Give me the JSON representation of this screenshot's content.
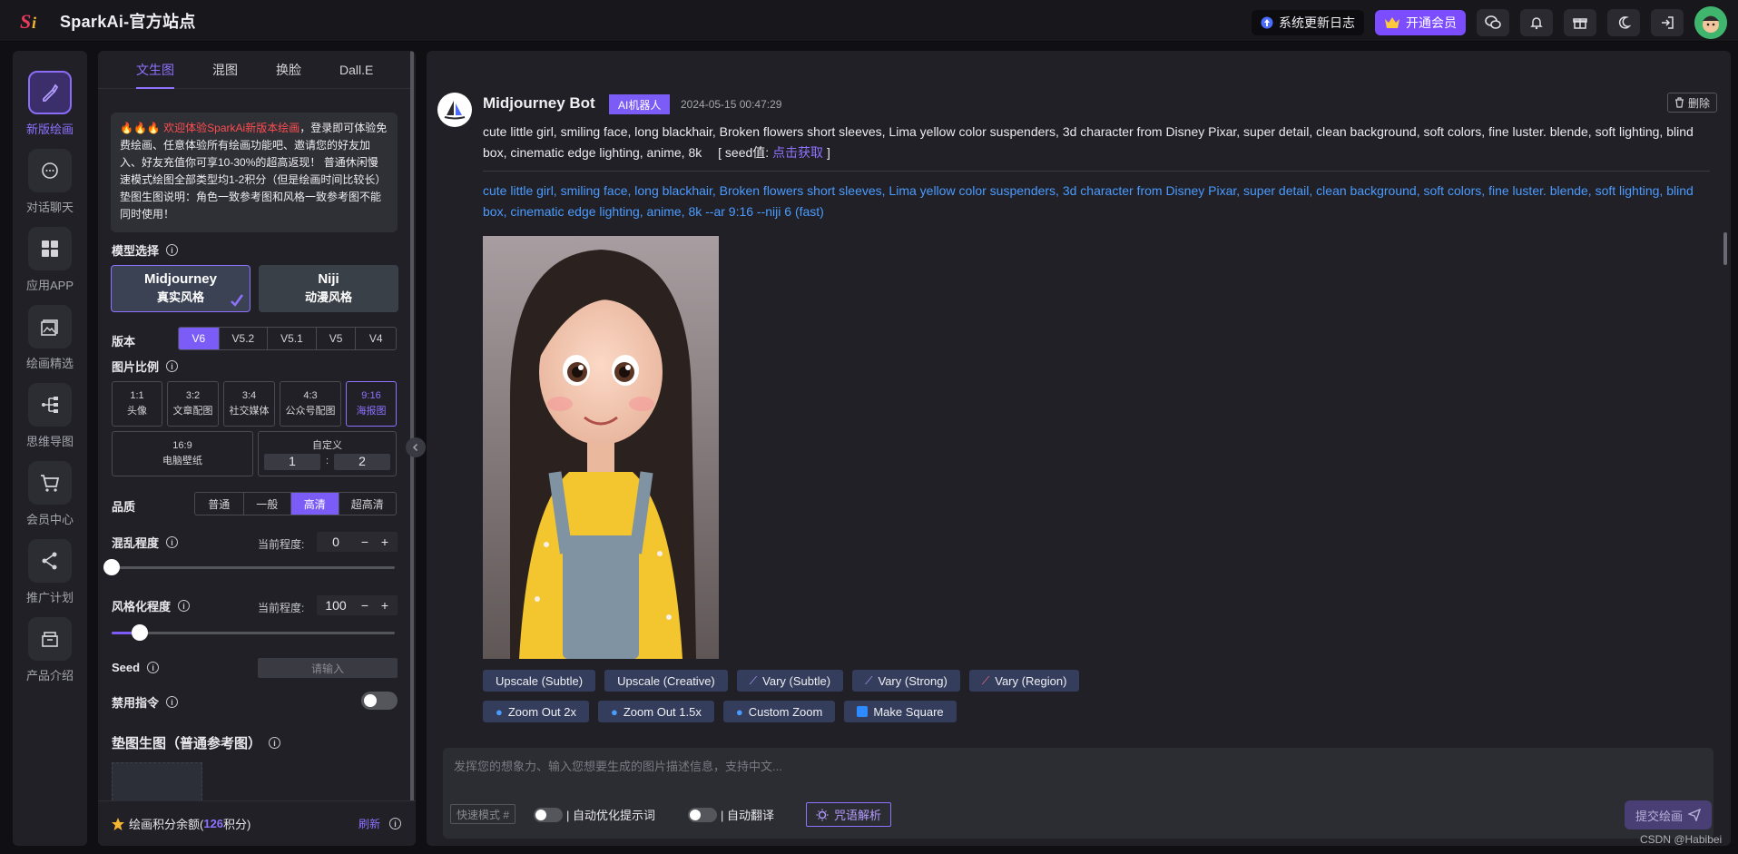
{
  "app": {
    "title": "SparkAi-官方站点",
    "logo_text": "Si"
  },
  "topbar": {
    "changelog_label": "系统更新日志",
    "vip_label": "开通会员",
    "icons": [
      "wechat-icon",
      "bell-icon",
      "gift-icon",
      "moon-icon",
      "login-icon"
    ]
  },
  "leftnav": {
    "items": [
      {
        "label": "新版绘画",
        "icon": "paint-icon"
      },
      {
        "label": "对话聊天",
        "icon": "chat-icon"
      },
      {
        "label": "应用APP",
        "icon": "apps-icon"
      },
      {
        "label": "绘画精选",
        "icon": "gallery-icon"
      },
      {
        "label": "思维导图",
        "icon": "mindmap-icon"
      },
      {
        "label": "会员中心",
        "icon": "cart-icon"
      },
      {
        "label": "推广计划",
        "icon": "share-icon"
      },
      {
        "label": "产品介绍",
        "icon": "product-icon"
      }
    ]
  },
  "panel": {
    "tabs": [
      "文生图",
      "混图",
      "换脸",
      "Dall.E"
    ],
    "notice": {
      "emoji": "🔥🔥🔥",
      "highlight": "欢迎体验SparkAi新版本绘画",
      "body": "，登录即可体验免费绘画、任意体验所有绘画功能吧、邀请您的好友加入、好友充值你可享10-30%的超高返现！ 普通休闲慢速模式绘图全部类型均1-2积分（但是绘画时间比较长）垫图生图说明：角色一致参考图和风格一致参考图不能同时使用！"
    },
    "model_label": "模型选择",
    "models": [
      {
        "name": "Midjourney",
        "sub": "真实风格"
      },
      {
        "name": "Niji",
        "sub": "动漫风格"
      }
    ],
    "version_label": "版本",
    "versions": [
      "V6",
      "V5.2",
      "V5.1",
      "V5",
      "V4"
    ],
    "ratio_label": "图片比例",
    "ratios": [
      {
        "ratio": "1:1",
        "name": "头像"
      },
      {
        "ratio": "3:2",
        "name": "文章配图"
      },
      {
        "ratio": "3:4",
        "name": "社交媒体"
      },
      {
        "ratio": "4:3",
        "name": "公众号配图"
      },
      {
        "ratio": "9:16",
        "name": "海报图"
      },
      {
        "ratio": "16:9",
        "name": "电脑壁纸"
      }
    ],
    "custom": {
      "label": "自定义",
      "w": "1",
      "sep": ":",
      "h": "2"
    },
    "quality_label": "品质",
    "qualities": [
      "普通",
      "一般",
      "高清",
      "超高清"
    ],
    "chaos": {
      "label": "混乱程度",
      "current_label": "当前程度:",
      "value": "0",
      "level": 0.0
    },
    "stylize": {
      "label": "风格化程度",
      "current_label": "当前程度:",
      "value": "100",
      "level": 0.1
    },
    "seed": {
      "label": "Seed",
      "placeholder": "请输入"
    },
    "no_cmd_label": "禁用指令",
    "ref_label": "垫图生图（普通参考图）",
    "footer": {
      "points_prefix": "绘画积分余额(",
      "points_value": "126",
      "points_suffix": "积分)",
      "refresh": "刷新"
    }
  },
  "message": {
    "bot_name": "Midjourney Bot",
    "badge": "AI机器人",
    "time": "2024-05-15 00:47:29",
    "delete_label": "删除",
    "prompt": "cute little girl, smiling face, long blackhair, Broken flowers short sleeves, Lima yellow color suspenders, 3d character from Disney Pixar, super detail, clean background, soft colors, fine luster. blende, soft lighting, blind box, cinematic edge lighting, anime, 8k",
    "seed_prefix": "[ seed值: ",
    "seed_link": "点击获取",
    "seed_suffix": " ]",
    "final_prompt": "cute little girl, smiling face, long blackhair, Broken flowers short sleeves, Lima yellow color suspenders, 3d character from Disney Pixar, super detail, clean background, soft colors, fine luster. blende, soft lighting, blind box, cinematic edge lighting, anime, 8k --ar 9:16 --niji 6  (fast)",
    "actions_row1": [
      {
        "label": "Upscale (Subtle)",
        "icon": ""
      },
      {
        "label": "Upscale (Creative)",
        "icon": ""
      },
      {
        "label": "Vary (Subtle)",
        "icon": "magic-wand-icon"
      },
      {
        "label": "Vary (Strong)",
        "icon": "magic-wand-icon"
      },
      {
        "label": "Vary (Region)",
        "icon": "brush-icon"
      }
    ],
    "actions_row2": [
      {
        "label": "Zoom Out 2x",
        "icon": "zoom-icon"
      },
      {
        "label": "Zoom Out 1.5x",
        "icon": "zoom-icon"
      },
      {
        "label": "Custom Zoom",
        "icon": "zoom-icon"
      },
      {
        "label": "Make Square",
        "icon": "square-icon"
      }
    ]
  },
  "composer": {
    "placeholder": "发挥您的想象力、输入您想要生成的图片描述信息，支持中文...",
    "quick_mode": "快速模式 #",
    "auto_optimize": "自动优化提示词",
    "auto_translate": "自动翻译",
    "spell_label": "咒语解析",
    "submit_label": "提交绘画"
  },
  "watermark": "CSDN @Habibei",
  "colors": {
    "accent": "#7c5cf6",
    "link": "#4b9bff",
    "alert": "#ff4d4f"
  }
}
